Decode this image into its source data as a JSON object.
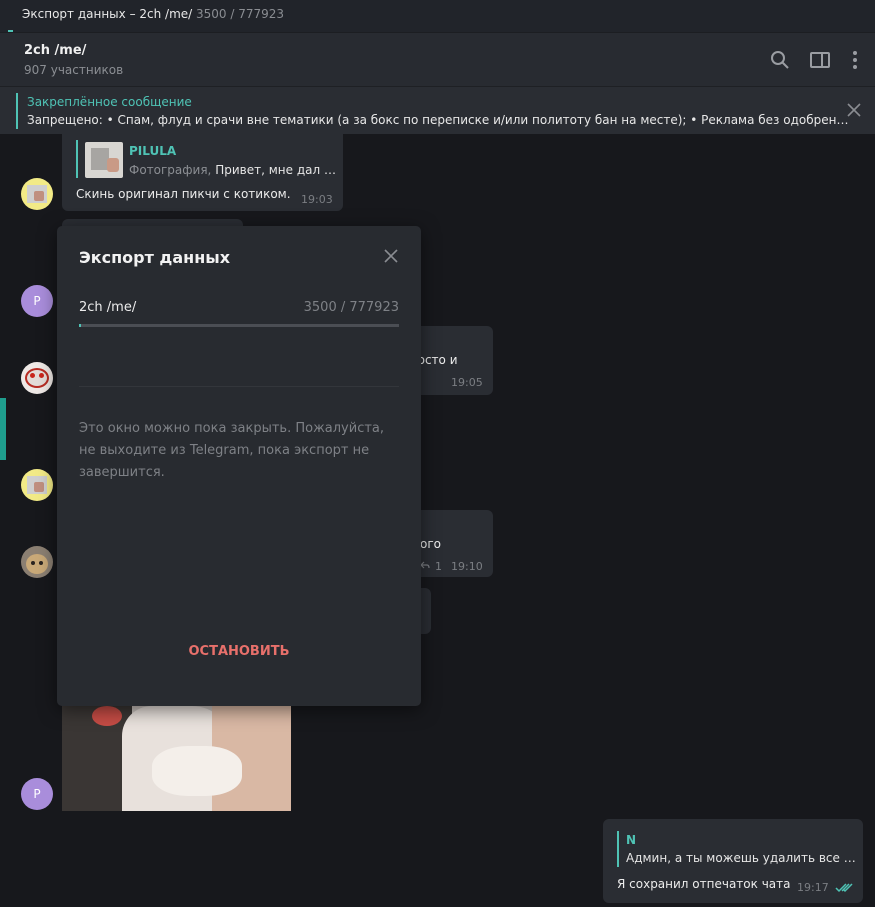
{
  "window": {
    "title": "Экспорт данных – 2ch /me/",
    "title_progress": "3500 / 777923"
  },
  "chat_header": {
    "name": "2ch /me/",
    "members": "907 участников",
    "icons": [
      "search-icon",
      "sidebar-toggle-icon",
      "more-vertical-icon"
    ]
  },
  "pinned": {
    "title": "Закреплённое сообщение",
    "text": "Запрещено: • Спам, флуд и срачи вне тематики (а за бокс по переписке и/или политоту бан на месте); • Реклама без одобрен…"
  },
  "messages": {
    "m1": {
      "reply_author": "PILULA",
      "reply_type": "Фотография,",
      "reply_text": "Привет, мне дал …",
      "text": "Скинь оригинал пикчи с котиком.",
      "time": "19:03"
    },
    "m2": {
      "avatar_letter": "P"
    },
    "m3": {
      "text_fragment": "росто и",
      "time": "19:05"
    },
    "m5": {
      "text_fragment": "ого",
      "replies": "1",
      "time": "19:10"
    },
    "m6": {
      "avatar_letter": "P"
    },
    "own": {
      "reply_author": "N",
      "reply_text": "Админ, а ты можешь удалить все …",
      "text": "Я сохранил отпечаток чата",
      "time": "19:17"
    }
  },
  "export_dialog": {
    "title": "Экспорт данных",
    "chat_name": "2ch /me/",
    "progress_text": "3500 / 777923",
    "progress_fraction": 0.0045,
    "note": "Это окно можно пока закрыть. Пожалуйста, не выходите из Telegram, пока экспорт не завершится.",
    "stop_label": "ОСТАНОВИТЬ"
  },
  "colors": {
    "accent": "#4fc3b5",
    "danger": "#e8706b",
    "bubble": "#2a2d33",
    "background": "#17181c"
  }
}
